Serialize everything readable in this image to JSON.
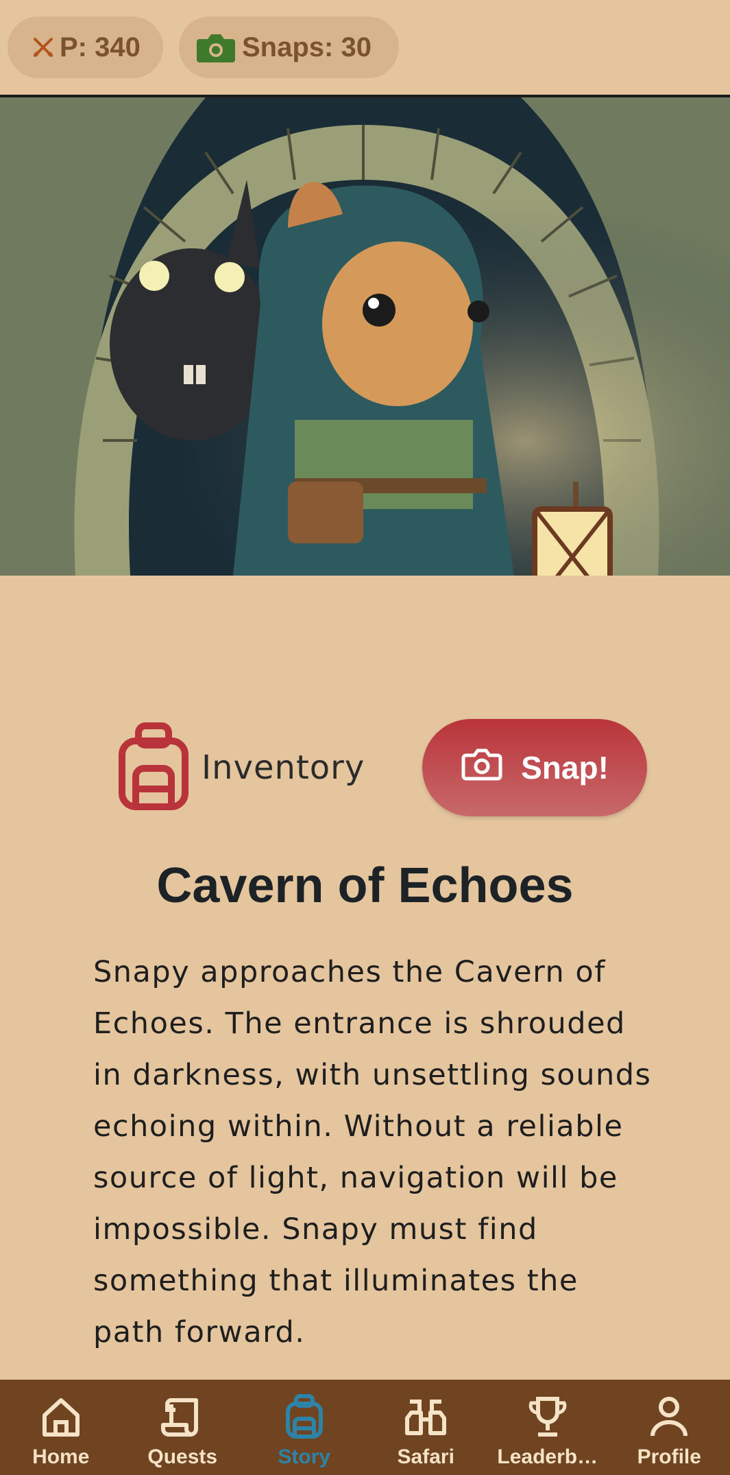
{
  "status": {
    "points_label": "P: 340",
    "snaps_label": "Snaps: 30"
  },
  "hero": {
    "alt": "Hooded rodent adventurer holding a lantern at a cave entrance while a dark creature lurks behind"
  },
  "actions": {
    "inventory_label": "Inventory",
    "snap_label": "Snap!"
  },
  "story": {
    "title": "Cavern of Echoes",
    "text": "Snapy approaches the Cavern of Echoes. The entrance is shrouded in darkness, with unsettling sounds echoing within. Without a reliable source of light, navigation will be impossible. Snapy must find something that illuminates the path forward."
  },
  "nav": {
    "items": [
      {
        "label": "Home",
        "icon": "home-icon"
      },
      {
        "label": "Quests",
        "icon": "scroll-icon"
      },
      {
        "label": "Story",
        "icon": "backpack-icon",
        "active": true
      },
      {
        "label": "Safari",
        "icon": "binoculars-icon"
      },
      {
        "label": "Leaderb…",
        "icon": "trophy-icon"
      },
      {
        "label": "Profile",
        "icon": "person-icon"
      }
    ]
  },
  "colors": {
    "background": "#e4c59e",
    "nav_bg": "#704321",
    "nav_active": "#2c84a8",
    "accent_red": "#b9343a",
    "snaps_icon": "#3f7a2c"
  }
}
